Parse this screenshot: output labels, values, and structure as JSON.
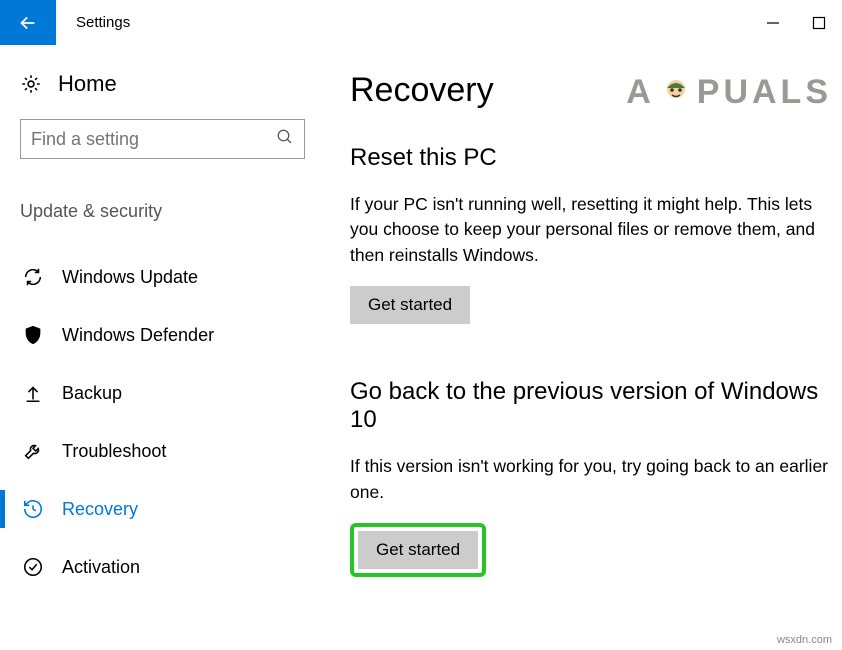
{
  "titlebar": {
    "title": "Settings"
  },
  "sidebar": {
    "home": "Home",
    "search_placeholder": "Find a setting",
    "category": "Update & security",
    "items": [
      {
        "label": "Windows Update"
      },
      {
        "label": "Windows Defender"
      },
      {
        "label": "Backup"
      },
      {
        "label": "Troubleshoot"
      },
      {
        "label": "Recovery"
      },
      {
        "label": "Activation"
      }
    ]
  },
  "main": {
    "heading": "Recovery",
    "reset": {
      "heading": "Reset this PC",
      "desc": "If your PC isn't running well, resetting it might help. This lets you choose to keep your personal files or remove them, and then reinstalls Windows.",
      "button": "Get started"
    },
    "goback": {
      "heading": "Go back to the previous version of Windows 10",
      "desc": "If this version isn't working for you, try going back to an earlier one.",
      "button": "Get started"
    }
  },
  "watermark": "APPUALS",
  "footer": "wsxdn.com"
}
